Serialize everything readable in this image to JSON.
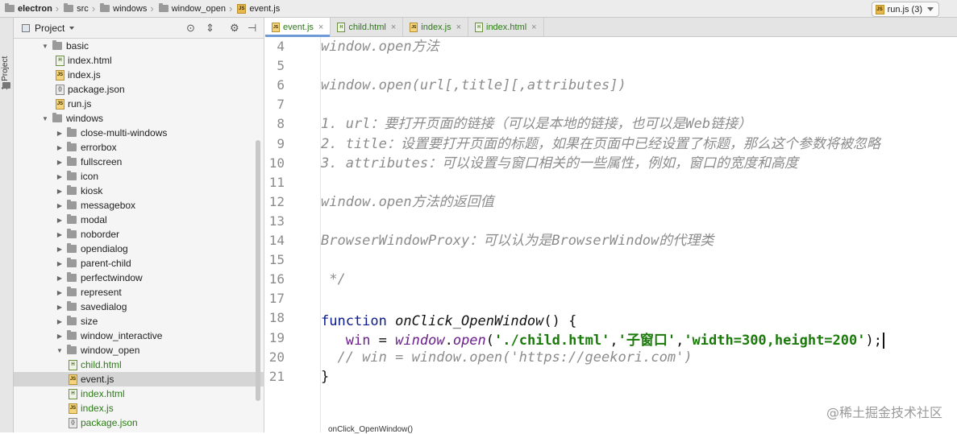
{
  "navbar": {
    "crumbs": [
      "electron",
      "src",
      "windows",
      "window_open",
      "event.js"
    ],
    "run_config": "run.js (3)"
  },
  "left_strip": {
    "label": "1: Project"
  },
  "project": {
    "title": "Project",
    "tree": [
      {
        "label": "basic",
        "kind": "folder",
        "open": true,
        "indent": 1
      },
      {
        "label": "index.html",
        "kind": "html",
        "indent": 2
      },
      {
        "label": "index.js",
        "kind": "js",
        "indent": 2
      },
      {
        "label": "package.json",
        "kind": "json",
        "indent": 2
      },
      {
        "label": "run.js",
        "kind": "js",
        "indent": 2
      },
      {
        "label": "windows",
        "kind": "folder",
        "open": true,
        "indent": 1
      },
      {
        "label": "close-multi-windows",
        "kind": "folder",
        "indent": 2
      },
      {
        "label": "errorbox",
        "kind": "folder",
        "indent": 2
      },
      {
        "label": "fullscreen",
        "kind": "folder",
        "indent": 2
      },
      {
        "label": "icon",
        "kind": "folder",
        "indent": 2
      },
      {
        "label": "kiosk",
        "kind": "folder",
        "indent": 2
      },
      {
        "label": "messagebox",
        "kind": "folder",
        "indent": 2
      },
      {
        "label": "modal",
        "kind": "folder",
        "indent": 2
      },
      {
        "label": "noborder",
        "kind": "folder",
        "indent": 2
      },
      {
        "label": "opendialog",
        "kind": "folder",
        "indent": 2
      },
      {
        "label": "parent-child",
        "kind": "folder",
        "indent": 2
      },
      {
        "label": "perfectwindow",
        "kind": "folder",
        "indent": 2
      },
      {
        "label": "represent",
        "kind": "folder",
        "indent": 2
      },
      {
        "label": "savedialog",
        "kind": "folder",
        "indent": 2
      },
      {
        "label": "size",
        "kind": "folder",
        "indent": 2
      },
      {
        "label": "window_interactive",
        "kind": "folder",
        "indent": 2
      },
      {
        "label": "window_open",
        "kind": "folder",
        "open": true,
        "indent": 2
      },
      {
        "label": "child.html",
        "kind": "html",
        "indent": 3,
        "green": true
      },
      {
        "label": "event.js",
        "kind": "js",
        "indent": 3,
        "selected": true
      },
      {
        "label": "index.html",
        "kind": "html",
        "indent": 3,
        "green": true
      },
      {
        "label": "index.js",
        "kind": "js",
        "indent": 3,
        "green": true
      },
      {
        "label": "package.json",
        "kind": "json",
        "indent": 3,
        "green": true
      }
    ]
  },
  "tabs": [
    {
      "label": "event.js",
      "kind": "js",
      "active": true
    },
    {
      "label": "child.html",
      "kind": "html"
    },
    {
      "label": "index.js",
      "kind": "js"
    },
    {
      "label": "index.html",
      "kind": "html"
    }
  ],
  "code_lines": [
    {
      "num": "4",
      "text": "window.open方法"
    },
    {
      "num": "5",
      "text": ""
    },
    {
      "num": "6",
      "text": "window.open(url[,title][,attributes])"
    },
    {
      "num": "7",
      "text": ""
    },
    {
      "num": "8",
      "text": "1. url：要打开页面的链接（可以是本地的链接，也可以是Web链接）"
    },
    {
      "num": "9",
      "text": "2. title：设置要打开页面的标题，如果在页面中已经设置了标题，那么这个参数将被忽略"
    },
    {
      "num": "10",
      "text": "3. attributes：可以设置与窗口相关的一些属性，例如，窗口的宽度和高度"
    },
    {
      "num": "11",
      "text": ""
    },
    {
      "num": "12",
      "text": "window.open方法的返回值"
    },
    {
      "num": "13",
      "text": ""
    },
    {
      "num": "14",
      "text": "BrowserWindowProxy：可以认为是BrowserWindow的代理类"
    },
    {
      "num": "15",
      "text": ""
    },
    {
      "num": "16",
      "text": " */"
    },
    {
      "num": "17",
      "text": ""
    },
    {
      "num": "18",
      "text": ""
    },
    {
      "num": "19",
      "text": ""
    },
    {
      "num": "20",
      "text": "  // win = window.open('https://geekori.com')"
    },
    {
      "num": "21",
      "text": "}"
    }
  ],
  "code_18": {
    "kw": "function",
    "fn": "onClick_OpenWindow",
    "rest": "() {"
  },
  "code_19": {
    "var": "win",
    "eq": " = ",
    "glob": "window",
    "dot": ".",
    "method": "open",
    "open_paren": "(",
    "s1": "'./child.html'",
    "comma1": ",",
    "s2": "'子窗口'",
    "comma2": ",",
    "s3": "'width=300,height=200'",
    "close": ");"
  },
  "bottom_breadcrumb": "onClick_OpenWindow()",
  "watermark": "@稀土掘金技术社区"
}
